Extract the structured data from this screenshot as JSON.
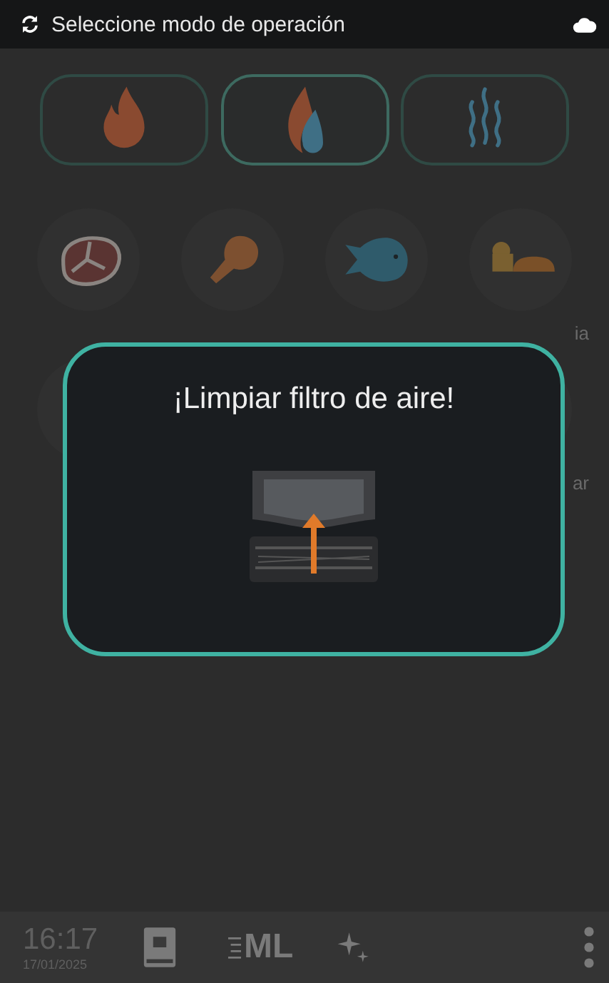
{
  "top_bar": {
    "title": "Seleccione modo de operación"
  },
  "modes": [
    {
      "kind": "fire",
      "selected": false
    },
    {
      "kind": "combi",
      "selected": true
    },
    {
      "kind": "steam",
      "selected": false
    }
  ],
  "food_rows": [
    [
      {
        "kind": "meat"
      },
      {
        "kind": "chicken"
      },
      {
        "kind": "fish"
      },
      {
        "kind": "bakery",
        "label": "ia"
      }
    ],
    [
      {
        "kind": "blank"
      },
      {
        "kind": "blank",
        "label": "ar"
      }
    ]
  ],
  "dialog": {
    "title": "¡Limpiar filtro de aire!"
  },
  "bottom_bar": {
    "time": "16:17",
    "date": "17/01/2025",
    "ml_label": "ML"
  }
}
